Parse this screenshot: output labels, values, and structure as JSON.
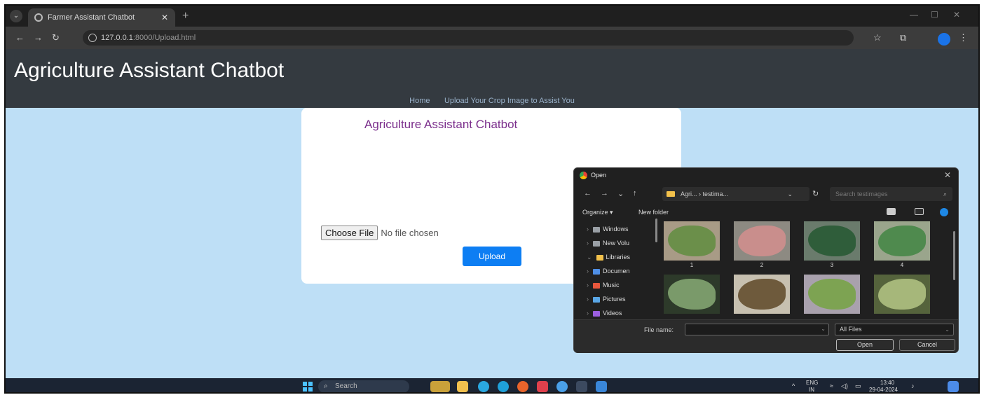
{
  "browser": {
    "tab_title": "Farmer Assistant Chatbot",
    "url_host": "127.0.0.1",
    "url_rest": ":8000/Upload.html"
  },
  "header": {
    "title": "Agriculture Assistant Chatbot",
    "nav": [
      "Home",
      "Upload Your Crop Image to Assist You"
    ]
  },
  "card": {
    "title": "Agriculture Assistant Chatbot",
    "choose_file": "Choose File",
    "no_file": "No file chosen",
    "upload": "Upload"
  },
  "dialog": {
    "title": "Open",
    "path": "Agri... › testima...",
    "search_placeholder": "Search testimages",
    "organize": "Organize ▾",
    "new_folder": "New folder",
    "tree": [
      {
        "label": "Windows",
        "arrow": "›",
        "color": "#9aa0a6"
      },
      {
        "label": "New Volu",
        "arrow": "›",
        "color": "#9aa0a6"
      },
      {
        "label": "Libraries",
        "arrow": "⌄",
        "color": "#f3c14b"
      },
      {
        "label": "Documen",
        "arrow": "›",
        "color": "#4f8fe6"
      },
      {
        "label": "Music",
        "arrow": "›",
        "color": "#e8573c"
      },
      {
        "label": "Pictures",
        "arrow": "›",
        "color": "#5aa7e6"
      },
      {
        "label": "Videos",
        "arrow": "›",
        "color": "#9b5fe0"
      }
    ],
    "images": [
      {
        "label": "1",
        "bg": "#a89b86",
        "leaf": "#6b8f4a"
      },
      {
        "label": "2",
        "bg": "#8d8a82",
        "leaf": "#c98e8c"
      },
      {
        "label": "3",
        "bg": "#6a7b6c",
        "leaf": "#2f5d3a"
      },
      {
        "label": "4",
        "bg": "#9aa58c",
        "leaf": "#4f8a4e"
      },
      {
        "label": "",
        "bg": "#2d3a2a",
        "leaf": "#7a9a6a"
      },
      {
        "label": "",
        "bg": "#c7c0b0",
        "leaf": "#6e5a3c"
      },
      {
        "label": "",
        "bg": "#a9a1ad",
        "leaf": "#7da352"
      },
      {
        "label": "",
        "bg": "#55633c",
        "leaf": "#a6b77a"
      }
    ],
    "file_name_label": "File name:",
    "file_type": "All Files",
    "open": "Open",
    "cancel": "Cancel"
  },
  "taskbar": {
    "search": "Search",
    "lang": "ENG",
    "region": "IN",
    "time": "13:40",
    "date": "29-04-2024"
  }
}
